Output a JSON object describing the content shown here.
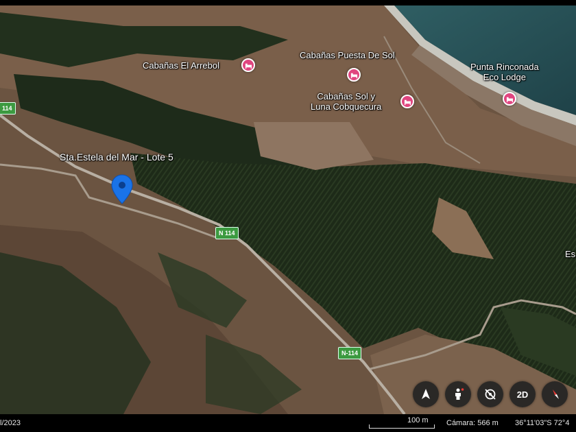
{
  "map": {
    "pins": [
      {
        "label": "Sta.Estela del Mar - Lote 5",
        "color": "#1a73e8"
      }
    ],
    "pois": [
      {
        "name": "Cabañas El Arrebol",
        "icon": "lodging-icon"
      },
      {
        "name": "Cabañas Puesta De Sol",
        "icon": "lodging-icon"
      },
      {
        "name": "Cabañas Sol y",
        "name_line2": "Luna Cobquecura",
        "icon": "lodging-icon"
      },
      {
        "name": "Punta Rinconada",
        "name_line2": "Eco Lodge",
        "icon": "lodging-icon"
      }
    ],
    "edge_labels": [
      "Es"
    ],
    "road_shields": [
      "114",
      "N 114",
      "N-114"
    ],
    "poi_color": "#e0457f",
    "road_shield_color": "#3c9a40"
  },
  "controls": [
    {
      "name": "navigate-icon",
      "label": ""
    },
    {
      "name": "street-view-icon",
      "label": ""
    },
    {
      "name": "rotate-tilt-icon",
      "label": ""
    },
    {
      "name": "view-2d",
      "label": "2D"
    },
    {
      "name": "compass-icon",
      "label": ""
    }
  ],
  "status_bar": {
    "date": "l/2023",
    "scale": "100 m",
    "camera": "Cámara: 566 m",
    "coordinates": "36°11'03\"S 72°4"
  }
}
